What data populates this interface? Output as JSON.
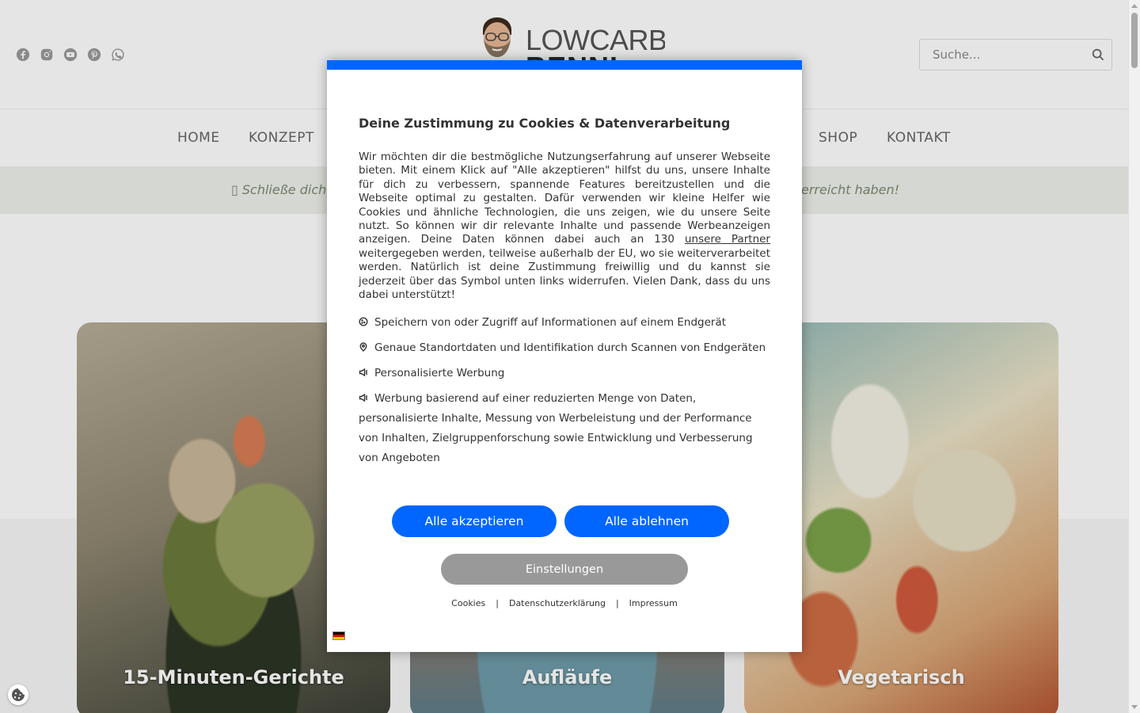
{
  "header": {
    "logo_text_top": "LOWCARB",
    "logo_text_bottom": "BENNI",
    "social_icons": [
      "facebook-icon",
      "instagram-icon",
      "youtube-icon",
      "pinterest-icon",
      "whatsapp-icon"
    ],
    "search_placeholder": "Suche..."
  },
  "nav": {
    "items": [
      "HOME",
      "KONZEPT",
      "SHOP",
      "KONTAKT"
    ]
  },
  "banner": {
    "left_text": "▯ Schließe dich",
    "right_text": "erreicht haben!"
  },
  "cards": [
    {
      "title": "15-Minuten-Gerichte"
    },
    {
      "title": "Aufläufe"
    },
    {
      "title": "Vegetarisch"
    }
  ],
  "modal": {
    "title": "Deine Zustimmung zu Cookies & Datenverarbeitung",
    "text_before_link": "Wir möchten dir die bestmögliche Nutzungserfahrung auf unserer Webseite bieten. Mit einem Klick auf \"Alle akzeptieren\" hilfst du uns, unsere Inhalte für dich zu verbessern, spannende Features bereitzustellen und die Webseite optimal zu gestalten. Dafür verwenden wir kleine Helfer wie Cookies und ähnliche Technologien, die uns zeigen, wie du unsere Seite nutzt. So können wir dir relevante Inhalte und passende Werbeanzeigen anzeigen. Deine Daten können dabei auch an 130 ",
    "partner_link": "unsere Partner",
    "text_after_link": " weitergegeben werden, teilweise außerhalb der EU, wo sie weiterverarbeitet werden. Natürlich ist deine Zustimmung freiwillig und du kannst sie jederzeit über das Symbol unten links widerrufen. Vielen Dank, dass du uns dabei unterstützt!",
    "purposes": [
      "Speichern von oder Zugriff auf Informationen auf einem Endgerät",
      "Genaue Standortdaten und Identifikation durch Scannen von Endgeräten",
      "Personalisierte Werbung",
      "Werbung basierend auf einer reduzierten Menge von Daten, personalisierte Inhalte, Messung von Werbeleistung und der Performance von Inhalten, Zielgruppenforschung sowie Entwicklung und Verbesserung von Angeboten"
    ],
    "purpose_icons": [
      "cookie-icon",
      "location-pin-icon",
      "megaphone-icon",
      "megaphone-icon"
    ],
    "accept_label": "Alle akzeptieren",
    "reject_label": "Alle ablehnen",
    "settings_label": "Einstellungen",
    "links": [
      "Cookies",
      "Datenschutzerklärung",
      "Impressum"
    ],
    "link_separator": "|",
    "accent_color": "#0066ff",
    "language_flag": "german-flag-icon"
  }
}
